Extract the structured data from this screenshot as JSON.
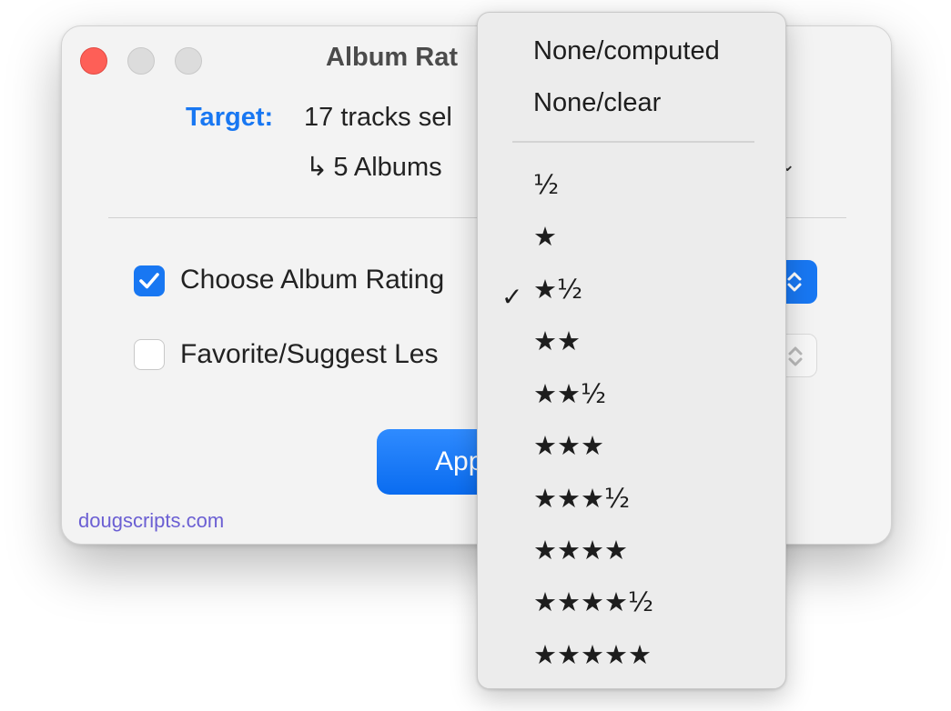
{
  "window": {
    "title": "Album Rat",
    "target_label": "Target:",
    "target_value": "17 tracks sel",
    "target_sub_arrow": "↳",
    "target_sub": "5 Albums",
    "chevron": "⌄",
    "choose_rating_label": "Choose Album Rating",
    "favorite_label": "Favorite/Suggest Les",
    "apply_label": "Apply",
    "footer": "dougscripts.com"
  },
  "checkboxes": {
    "choose_rating_checked": true,
    "favorite_checked": false
  },
  "menu": {
    "items": [
      "None/computed",
      "None/clear",
      "½",
      "★",
      "★½",
      "★★",
      "★★½",
      "★★★",
      "★★★½",
      "★★★★",
      "★★★★½",
      "★★★★★"
    ],
    "selected_index": 4,
    "checkmark": "✓"
  },
  "colors": {
    "accent": "#1877f2",
    "close": "#fe5f57",
    "link": "#6b5fd3"
  }
}
